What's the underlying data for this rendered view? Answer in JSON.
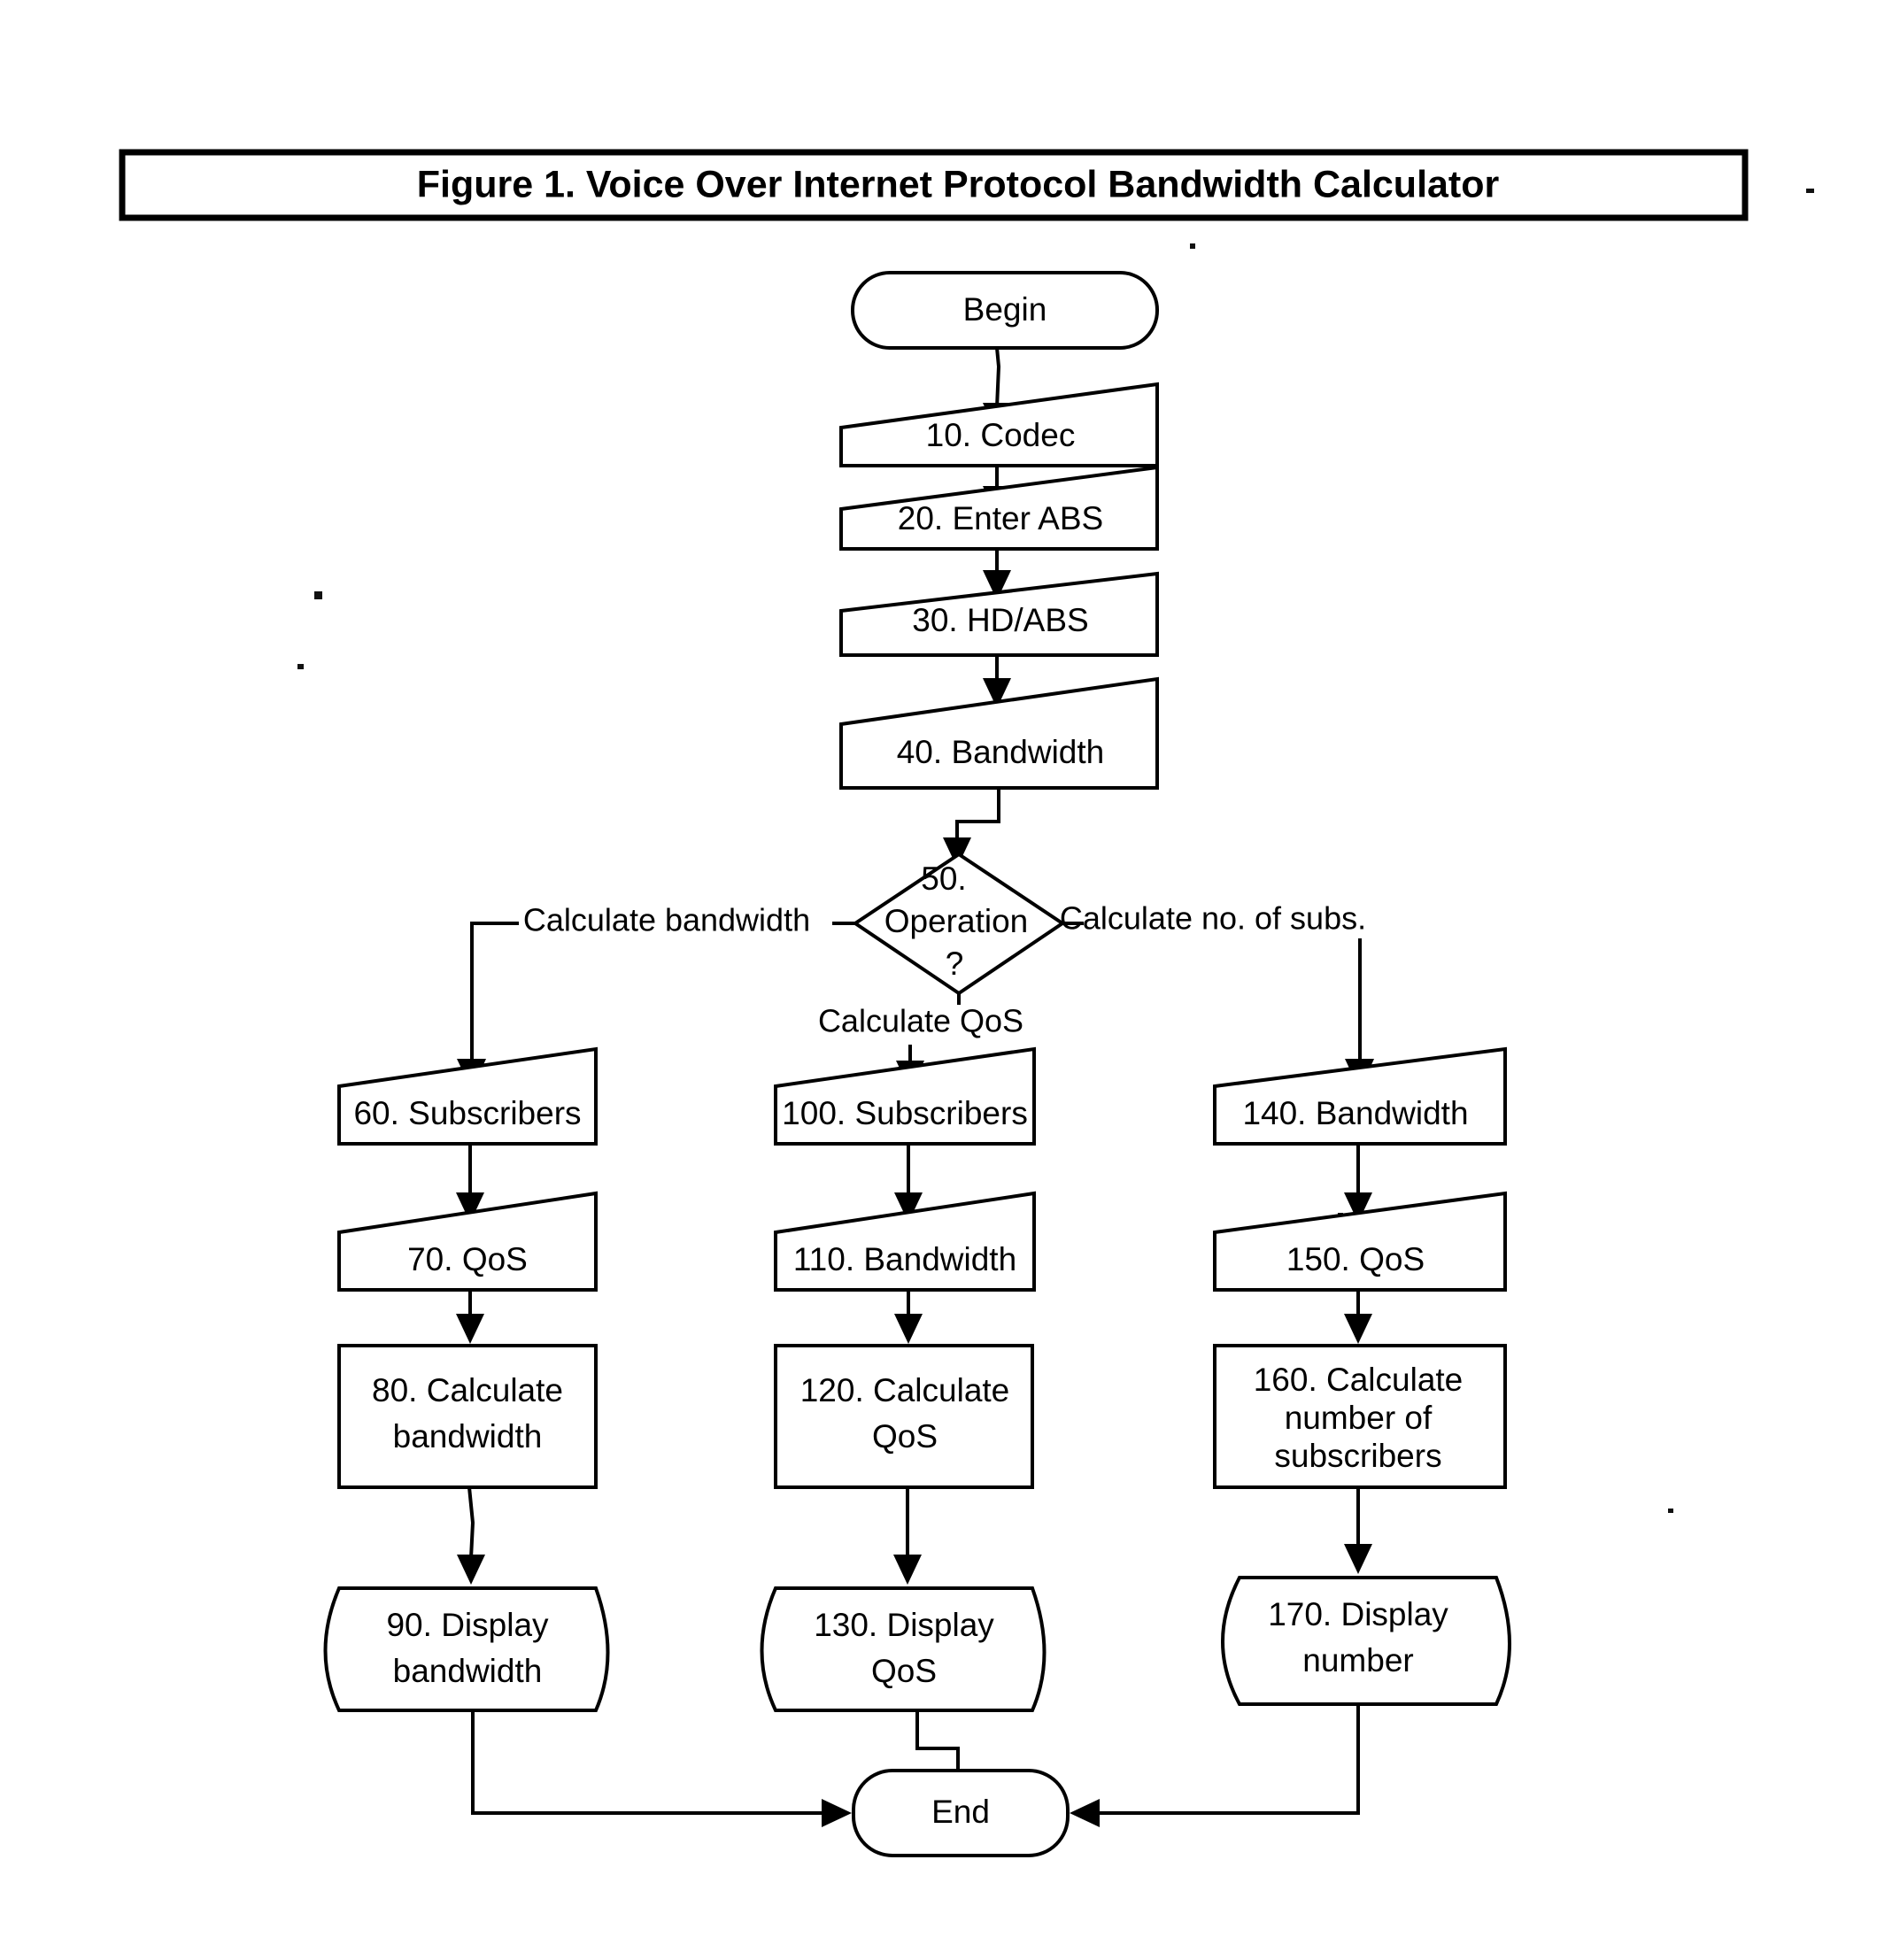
{
  "figure": {
    "title": "Figure 1. Voice Over Internet Protocol Bandwidth Calculator",
    "colors": {
      "ink": "#000000",
      "paper": "#ffffff"
    }
  },
  "nodes": {
    "begin": {
      "label": "Begin",
      "shape": "terminator"
    },
    "n10": {
      "label": "10. Codec",
      "shape": "input"
    },
    "n20": {
      "label": "20. Enter ABS",
      "shape": "input"
    },
    "n30": {
      "label": "30. HD/ABS",
      "shape": "input"
    },
    "n40": {
      "label": "40. Bandwidth",
      "shape": "input"
    },
    "n50": {
      "line1": "50.",
      "line2": "Operation",
      "line3": "?",
      "shape": "decision"
    },
    "n60": {
      "label": "60. Subscribers",
      "shape": "input"
    },
    "n70": {
      "label": "70. QoS",
      "shape": "input"
    },
    "n80": {
      "line1": "80. Calculate",
      "line2": "bandwidth",
      "shape": "process"
    },
    "n90": {
      "line1": "90. Display",
      "line2": "bandwidth",
      "shape": "display"
    },
    "n100": {
      "label": "100. Subscribers",
      "shape": "input"
    },
    "n110": {
      "label": "110. Bandwidth",
      "shape": "input"
    },
    "n120": {
      "line1": "120. Calculate",
      "line2": "QoS",
      "shape": "process"
    },
    "n130": {
      "line1": "130. Display",
      "line2": "QoS",
      "shape": "display"
    },
    "n140": {
      "label": "140. Bandwidth",
      "shape": "input"
    },
    "n150": {
      "label": "150. QoS",
      "shape": "input"
    },
    "n160": {
      "line1": "160. Calculate",
      "line2": "number of",
      "line3": "subscribers",
      "shape": "process"
    },
    "n170": {
      "line1": "170. Display",
      "line2": "number",
      "shape": "display"
    },
    "end": {
      "label": "End",
      "shape": "terminator"
    }
  },
  "branch_labels": {
    "left": "Calculate bandwidth",
    "down": "Calculate QoS",
    "right": "Calculate no. of subs."
  }
}
